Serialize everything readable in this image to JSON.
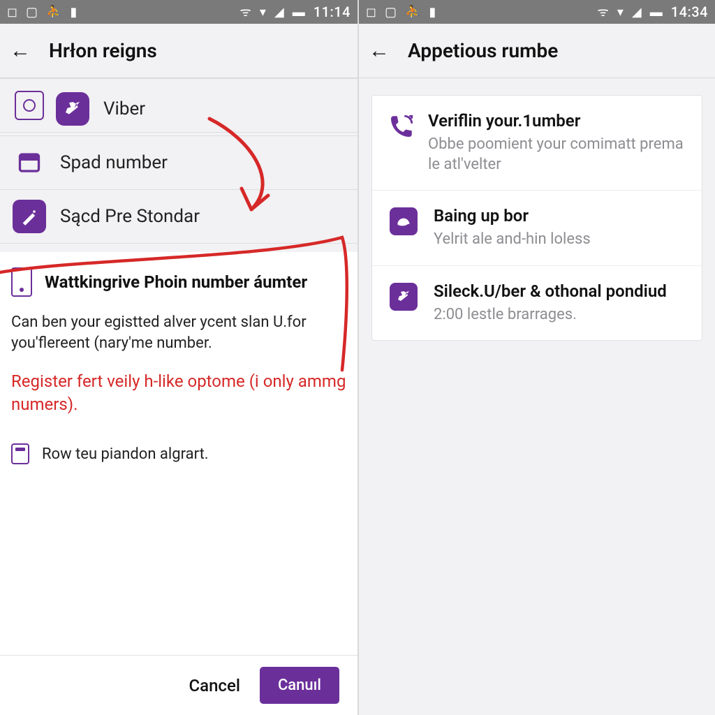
{
  "left": {
    "status": {
      "time": "11:14"
    },
    "appbar": {
      "title": "Hrłon reigns"
    },
    "rows": {
      "viber_label": "Viber",
      "spad_label": "Spad number",
      "pre_label": "Sącd Pre Stondar"
    },
    "panel": {
      "title": "Wattkingrive Phoin number áumter",
      "body": "Can ben your egistted alver ycent slan U.for you'flereent (nary'me number.",
      "red": "Register fert veily h-like optome (i only ammg numers).",
      "last": "Row teu piandon algrart."
    },
    "footer": {
      "cancel": "Cancel",
      "confirm": "Canuıl"
    }
  },
  "right": {
    "status": {
      "time": "14:34"
    },
    "appbar": {
      "title": "Appetious rumbe"
    },
    "cards": {
      "c1_title": "Veriflin your.1umber",
      "c1_sub": "Obbe poomient your comimatt prema le atl'velter",
      "c2_title": "Baing up bor",
      "c2_sub": "Yelrit ale and-hin loless",
      "c3_title": "Sileck.U/ber & othonal pondiud",
      "c3_sub": "2:00 lestle brarrages."
    }
  }
}
